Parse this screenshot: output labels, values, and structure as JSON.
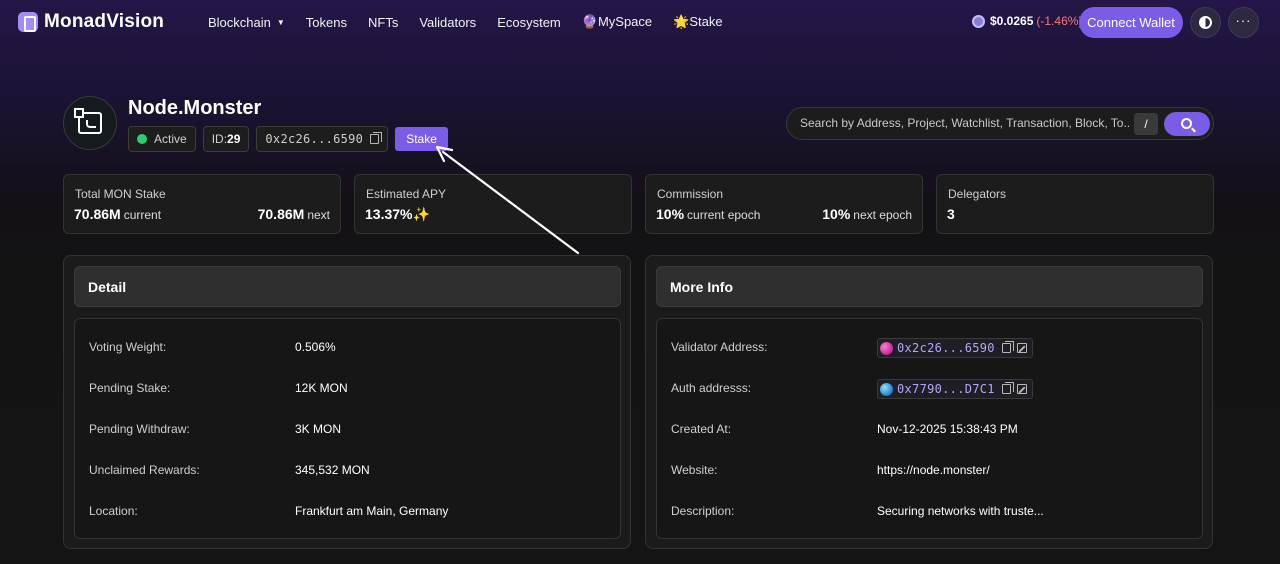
{
  "nav": {
    "logo_text": "MonadVision",
    "menu": [
      {
        "label": "Blockchain",
        "has_dropdown": true
      },
      {
        "label": "Tokens"
      },
      {
        "label": "NFTs"
      },
      {
        "label": "Validators"
      },
      {
        "label": "Ecosystem"
      },
      {
        "label": "🔮MySpace"
      },
      {
        "label": "🌟Stake"
      }
    ],
    "price": "$0.0265",
    "price_change": "(-1.46%)",
    "connect_label": "Connect Wallet",
    "dots": "···"
  },
  "validator": {
    "name": "Node.Monster",
    "status": "Active",
    "id_label": "ID:",
    "id_value": "29",
    "address_short": "0x2c26...6590",
    "stake_label": "Stake"
  },
  "search": {
    "placeholder": "Search by Address, Project, Watchlist, Transaction, Block, To...",
    "shortcut": "/"
  },
  "stats": {
    "total_stake": {
      "label": "Total MON Stake",
      "current_value": "70.86M",
      "current_sub": "current",
      "next_value": "70.86M",
      "next_sub": "next"
    },
    "apy": {
      "label": "Estimated APY",
      "value": "13.37%✨"
    },
    "commission": {
      "label": "Commission",
      "current_value": "10%",
      "current_sub": "current epoch",
      "next_value": "10%",
      "next_sub": "next epoch"
    },
    "delegators": {
      "label": "Delegators",
      "value": "3"
    }
  },
  "detail": {
    "title": "Detail",
    "rows": [
      {
        "label": "Voting Weight:",
        "value": "0.506%"
      },
      {
        "label": "Pending Stake:",
        "value": "12K MON"
      },
      {
        "label": "Pending Withdraw:",
        "value": "3K MON"
      },
      {
        "label": "Unclaimed Rewards:",
        "value": "345,532 MON"
      },
      {
        "label": "Location:",
        "value": "Frankfurt am Main, Germany"
      }
    ]
  },
  "more_info": {
    "title": "More Info",
    "validator_address": {
      "label": "Validator Address:",
      "value": "0x2c26...6590"
    },
    "auth_address": {
      "label": "Auth addresss:",
      "value": "0x7790...D7C1"
    },
    "created_at": {
      "label": "Created At:",
      "value": "Nov-12-2025 15:38:43 PM"
    },
    "website": {
      "label": "Website:",
      "value": "https://node.monster/"
    },
    "description": {
      "label": "Description:",
      "value": "Securing networks with truste..."
    }
  },
  "colors": {
    "accent": "#7b5ce6",
    "active": "#2ecc71",
    "negative": "#f27a7a",
    "link": "#b3a7f5"
  }
}
